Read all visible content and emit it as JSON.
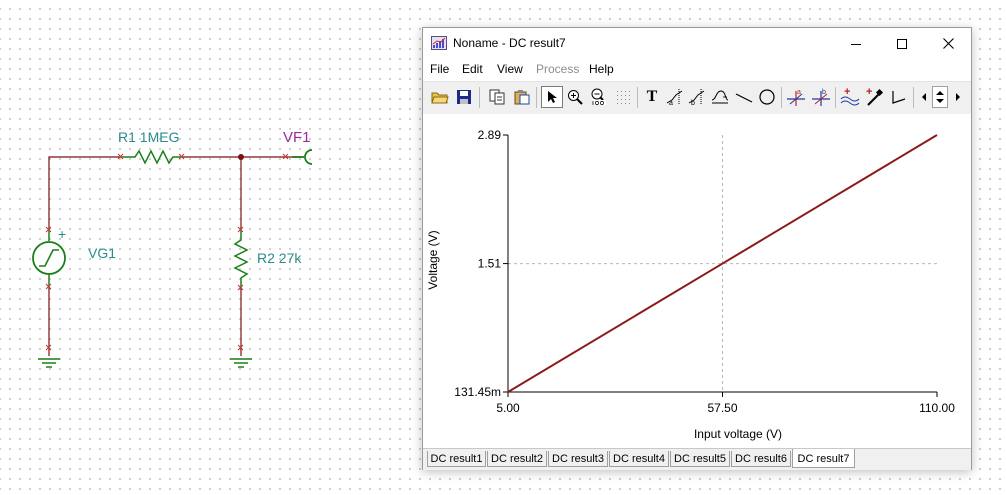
{
  "schematic": {
    "r1_label": "R1 1MEG",
    "r2_label": "R2 27k",
    "vg1_label": "VG1",
    "vg1_polarity": "+",
    "vf1_label": "VF1",
    "wire_color": "#7a1010",
    "component_color": "#1a7f1a"
  },
  "window": {
    "title": "Noname - DC result7",
    "controls": {
      "minimize": "–",
      "maximize": "□",
      "close": "✕"
    },
    "menu": [
      {
        "label": "File",
        "enabled": true
      },
      {
        "label": "Edit",
        "enabled": true
      },
      {
        "label": "View",
        "enabled": true
      },
      {
        "label": "Process",
        "enabled": false
      },
      {
        "label": "Help",
        "enabled": true
      }
    ],
    "toolbar_icons": [
      "open-folder-icon",
      "save-icon",
      "copy-icon",
      "paste-icon",
      "pointer-icon",
      "zoom-in-icon",
      "zoom-100-icon",
      "grid-icon",
      "text-icon",
      "cursor-a-icon",
      "cursor-b-icon",
      "curve-icon",
      "line-icon",
      "circle-icon",
      "marker-a-icon",
      "marker-b-icon",
      "waves-icon",
      "probe-icon",
      "angle-icon",
      "scroll-left-icon",
      "scroll-updown-icon",
      "scroll-right-icon"
    ],
    "toolbar_letters": {
      "text": "T",
      "marker_a": "a",
      "marker_b": "b"
    },
    "tabs": [
      "DC result1",
      "DC result2",
      "DC result3",
      "DC result4",
      "DC result5",
      "DC result6",
      "DC result7"
    ],
    "active_tab": "DC result7"
  },
  "chart_data": {
    "type": "line",
    "title": "",
    "xlabel": "Input voltage (V)",
    "ylabel": "Voltage (V)",
    "x_ticks": [
      "5.00",
      "57.50",
      "110.00"
    ],
    "y_ticks": [
      "131.45m",
      "1.51",
      "2.89"
    ],
    "xlim": [
      5.0,
      110.0
    ],
    "ylim": [
      0.13145,
      2.89
    ],
    "grid": true,
    "series": [
      {
        "color": "#8b1a1a",
        "x": [
          5.0,
          57.5,
          110.0
        ],
        "y": [
          0.13145,
          1.51,
          2.89
        ]
      }
    ]
  }
}
